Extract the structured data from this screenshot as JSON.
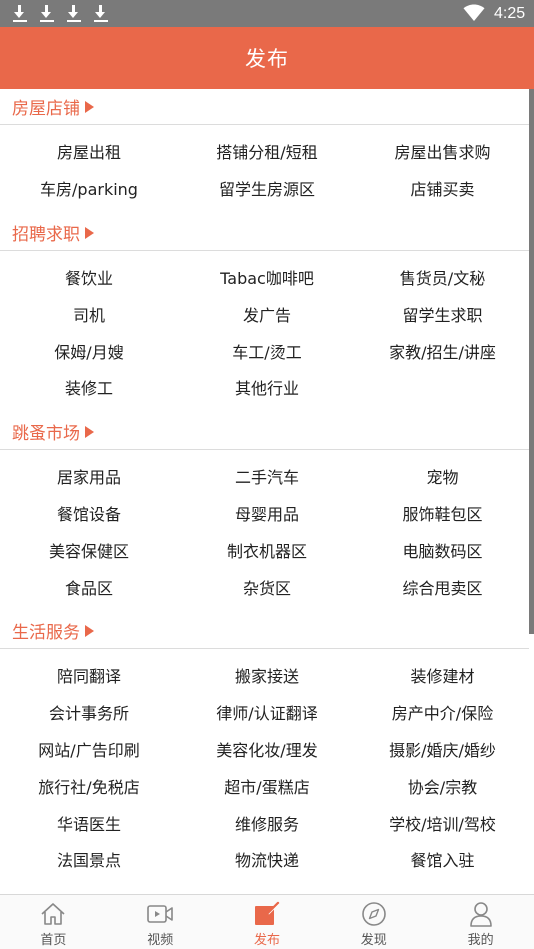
{
  "status_bar": {
    "time": "4:25"
  },
  "header": {
    "title": "发布"
  },
  "sections": [
    {
      "title": "房屋店铺",
      "items": [
        "房屋出租",
        "搭铺分租/短租",
        "房屋出售求购",
        "车房/parking",
        "留学生房源区",
        "店铺买卖"
      ]
    },
    {
      "title": "招聘求职",
      "items": [
        "餐饮业",
        "Tabac咖啡吧",
        "售货员/文秘",
        "司机",
        "发广告",
        "留学生求职",
        "保姆/月嫂",
        "车工/烫工",
        "家教/招生/讲座",
        "装修工",
        "其他行业"
      ]
    },
    {
      "title": "跳蚤市场",
      "items": [
        "居家用品",
        "二手汽车",
        "宠物",
        "餐馆设备",
        "母婴用品",
        "服饰鞋包区",
        "美容保健区",
        "制衣机器区",
        "电脑数码区",
        "食品区",
        "杂货区",
        "综合甩卖区"
      ]
    },
    {
      "title": "生活服务",
      "items": [
        "陪同翻译",
        "搬家接送",
        "装修建材",
        "会计事务所",
        "律师/认证翻译",
        "房产中介/保险",
        "网站/广告印刷",
        "美容化妆/理发",
        "摄影/婚庆/婚纱",
        "旅行社/免税店",
        "超市/蛋糕店",
        "协会/宗教",
        "华语医生",
        "维修服务",
        "学校/培训/驾校",
        "法国景点",
        "物流快递",
        "餐馆入驻"
      ]
    }
  ],
  "tabbar": [
    {
      "label": "首页",
      "icon": "home-icon"
    },
    {
      "label": "视频",
      "icon": "video-icon"
    },
    {
      "label": "发布",
      "icon": "publish-icon",
      "active": true
    },
    {
      "label": "发现",
      "icon": "compass-icon"
    },
    {
      "label": "我的",
      "icon": "user-icon"
    }
  ],
  "colors": {
    "accent": "#e9684a",
    "status_bar": "#7a7a7a",
    "text": "#222222",
    "divider": "#dcdcdc"
  }
}
